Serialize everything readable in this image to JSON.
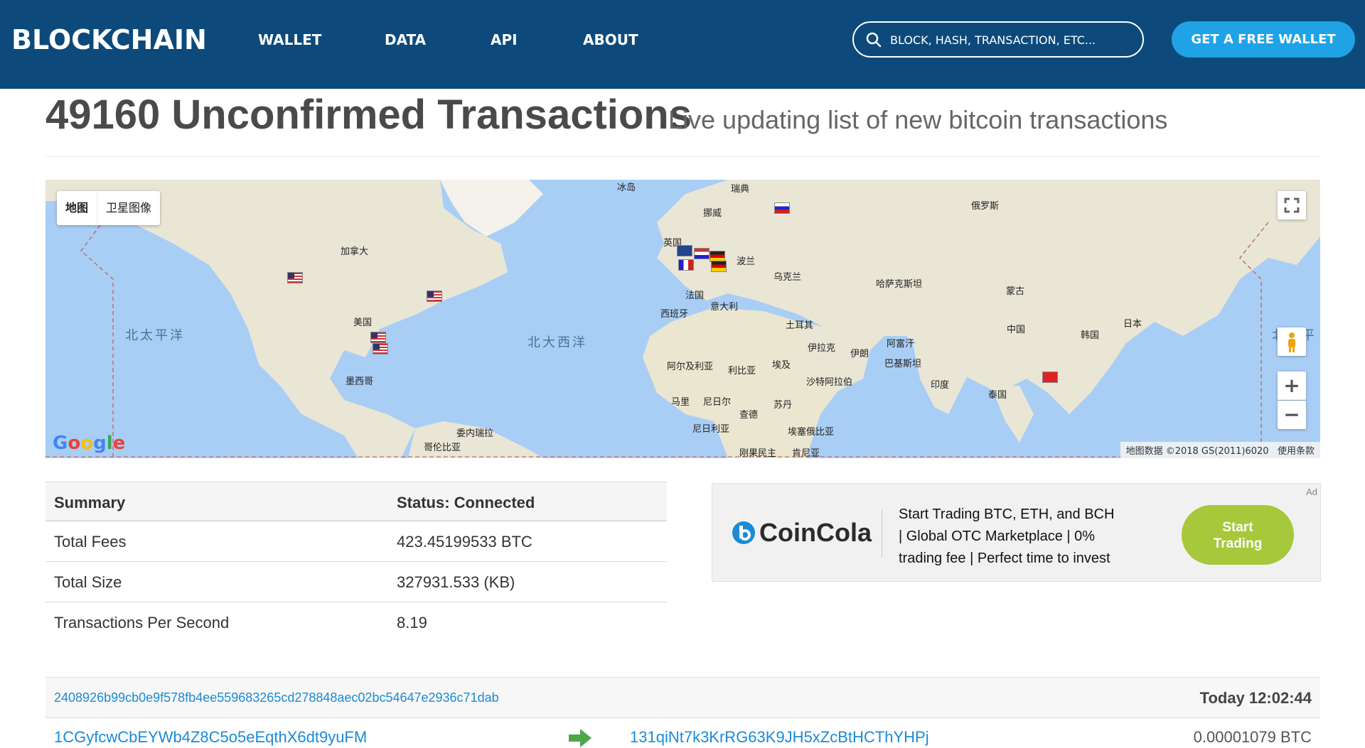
{
  "nav": {
    "logo": "BLOCKCHAIN",
    "links": [
      "WALLET",
      "DATA",
      "API",
      "ABOUT"
    ],
    "search_placeholder": "BLOCK, HASH, TRANSACTION, ETC...",
    "cta": "GET A FREE WALLET"
  },
  "header": {
    "title": "49160 Unconfirmed Transactions",
    "subtitle": "Live updating list of new bitcoin transactions"
  },
  "map": {
    "type_buttons": [
      "地图",
      "卫星图像"
    ],
    "labels": {
      "iceland": "冰岛",
      "sweden": "瑞典",
      "norway": "挪威",
      "russia": "俄罗斯",
      "uk": "英国",
      "poland": "波兰",
      "ukraine": "乌克兰",
      "kazakhstan": "哈萨克斯坦",
      "mongolia": "蒙古",
      "canada": "加拿大",
      "france": "法国",
      "spain": "西班牙",
      "italy": "意大利",
      "turkey": "土耳其",
      "iraq": "伊拉克",
      "iran": "伊朗",
      "afghanistan": "阿富汗",
      "pakistan": "巴基斯坦",
      "china": "中国",
      "korea": "韩国",
      "japan": "日本",
      "usa": "美国",
      "mexico": "墨西哥",
      "algeria": "阿尔及利亚",
      "libya": "利比亚",
      "egypt": "埃及",
      "saudi": "沙特阿拉伯",
      "india": "印度",
      "thailand": "泰国",
      "mali": "马里",
      "niger": "尼日尔",
      "chad": "查德",
      "sudan": "苏丹",
      "nigeria": "尼日利亚",
      "ethiopia": "埃塞俄比亚",
      "venezuela": "委内瑞拉",
      "colombia": "哥伦比亚",
      "drc": "刚果民主",
      "kenya": "肯尼亚",
      "north_pacific": "北太平洋",
      "north_atlantic": "北大西洋",
      "north_pacific_right": "北太平"
    },
    "attribution": "地图数据 ©2018 GS(2011)6020",
    "terms": "使用条款",
    "google": "Google",
    "zoom_in": "+",
    "zoom_out": "−"
  },
  "summary": {
    "header": [
      "Summary",
      "Status: Connected"
    ],
    "rows": [
      {
        "label": "Total Fees",
        "value": "423.45199533 BTC"
      },
      {
        "label": "Total Size",
        "value": "327931.533 (KB)"
      },
      {
        "label": "Transactions Per Second",
        "value": "8.19"
      }
    ]
  },
  "ad": {
    "tag": "Ad",
    "brand": "CoinCola",
    "text": "Start Trading BTC, ETH, and BCH | Global OTC Marketplace | 0% trading fee | Perfect time to invest",
    "lines": [
      "Start Trading BTC, ETH, and BCH",
      " | Global OTC Marketplace  |  0%",
      "trading fee  |  Perfect time to invest"
    ],
    "button": [
      "Start",
      "Trading"
    ],
    "button_color": "#a6c83a"
  },
  "transactions": [
    {
      "hash": "2408926b99cb0e9f578fb4ee559683265cd278848aec02bc54647e2936c71dab",
      "time": "Today 12:02:44",
      "from": "1CGyfcwCbEYWb4Z8C5o5eEqthX6dt9yuFM",
      "to": "131qiNt7k3KrRG63K9JH5xZcBtHCThYHPj",
      "amount": "0.00001079 BTC"
    }
  ],
  "colors": {
    "nav_bg": "#0d4a7b",
    "cta_bg": "#1fa3e6",
    "link": "#1a8bd6",
    "ocean": "#a9cef5",
    "land": "#eae6d8"
  }
}
